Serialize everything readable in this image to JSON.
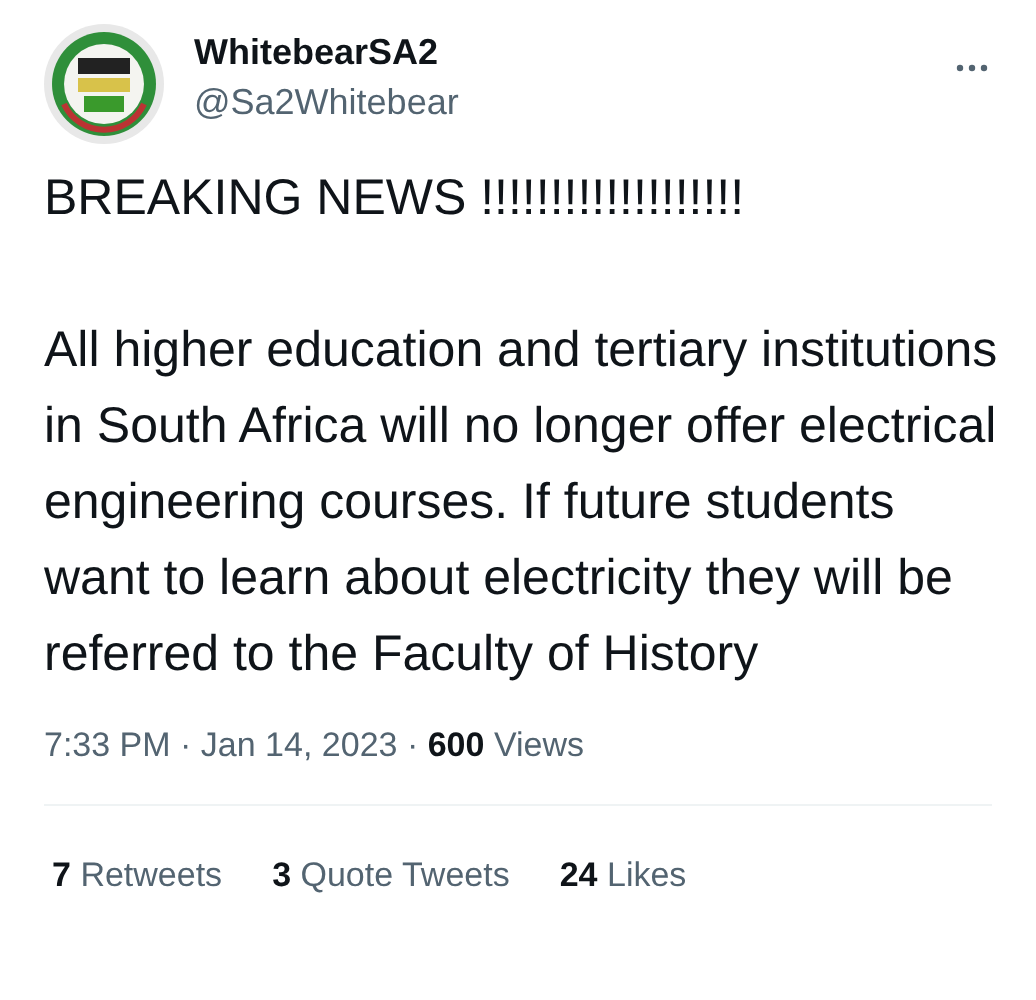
{
  "author": {
    "name": "WhitebearSA2",
    "handle": "@Sa2Whitebear"
  },
  "paragraphs": [
    "BREAKING NEWS !!!!!!!!!!!!!!!!!!!",
    "All higher education and tertiary institutions in South Africa will no longer offer electrical engineering courses. If future students want to learn about electricity they will be referred to the Faculty of History"
  ],
  "meta": "7:33 PM · Jan 14, 2023 · **600** Views",
  "stats": [
    {
      "count": "7",
      "label": "Retweets"
    },
    {
      "count": "3",
      "label": "Quote Tweets"
    },
    {
      "count": "24",
      "label": "Likes"
    }
  ]
}
